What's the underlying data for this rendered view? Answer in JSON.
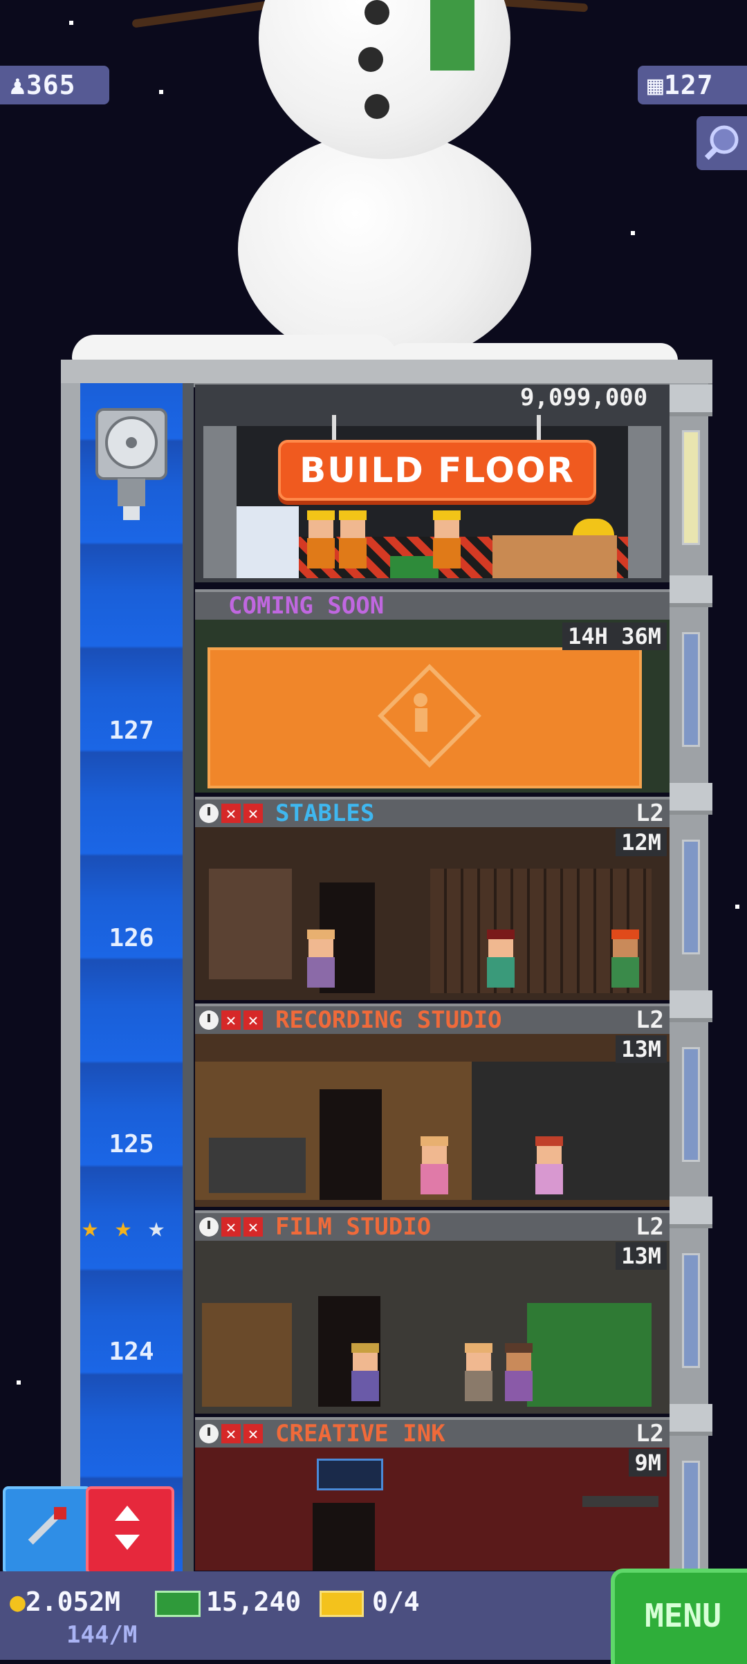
{
  "top_stats": {
    "population": "365",
    "floors": "127"
  },
  "build": {
    "price": "9,099,000",
    "button_label": "BUILD FLOOR",
    "next_label": "COMING SOON"
  },
  "construction": {
    "timer": "14H 36M"
  },
  "floors": [
    {
      "number": "127",
      "name": "STABLES",
      "level": "L2",
      "time": "12M",
      "name_color": "#3fb7f0"
    },
    {
      "number": "126",
      "name": "RECORDING STUDIO",
      "level": "L2",
      "time": "13M",
      "name_color": "#f06a3a"
    },
    {
      "number": "125",
      "name": "FILM STUDIO",
      "level": "L2",
      "time": "13M",
      "name_color": "#f06a3a"
    },
    {
      "number": "124",
      "name": "CREATIVE INK",
      "level": "L2",
      "time": "9M",
      "name_color": "#f06a3a"
    }
  ],
  "elevator_stars": {
    "filled": 2,
    "total": 3
  },
  "bottom": {
    "coins": "2.052M",
    "income": "144/M",
    "bux": "15,240",
    "tickets": "0/4",
    "menu_label": "MENU"
  },
  "colors": {
    "sky": "#0b0a1c",
    "shaft_blue": "#1a5fd8",
    "build_orange": "#f05a1f",
    "menu_green": "#2fae3a",
    "panel_purple": "#4b4f80"
  }
}
